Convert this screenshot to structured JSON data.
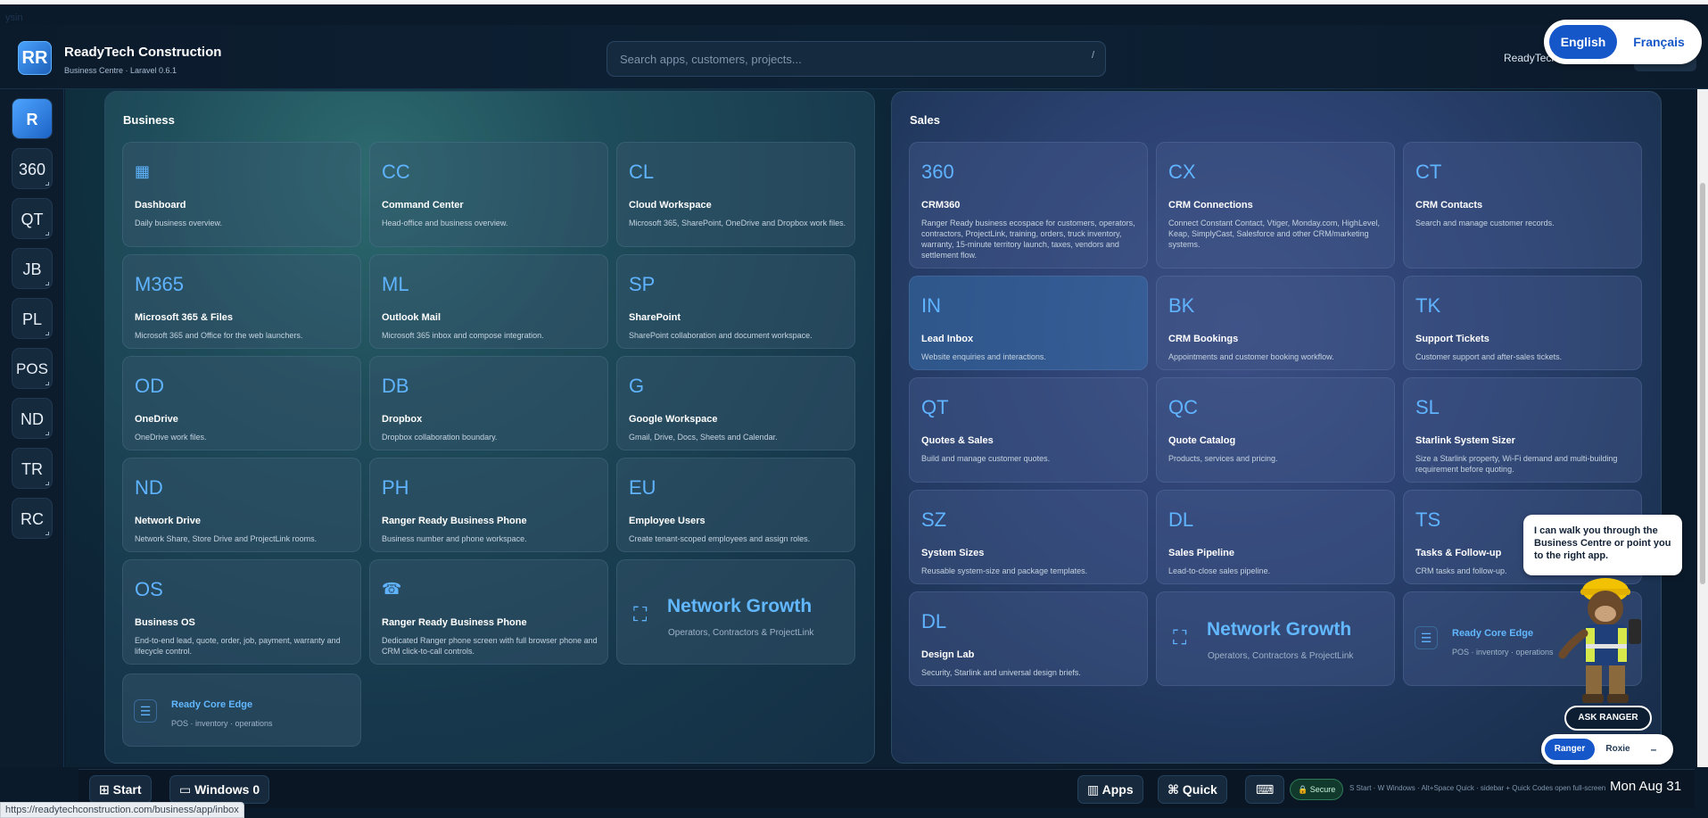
{
  "header": {
    "watermark": "ysin",
    "logo": "RR",
    "title": "ReadyTech Construction",
    "subtitle": "Business Centre · Laravel 0.6.1",
    "search_placeholder": "Search apps, customers, projects...",
    "search_hint": "/",
    "user_name": "ReadyTech"
  },
  "language": {
    "english": "English",
    "french": "Français"
  },
  "sidebar": [
    {
      "label": "R"
    },
    {
      "label": "360"
    },
    {
      "label": "QT"
    },
    {
      "label": "JB"
    },
    {
      "label": "PL"
    },
    {
      "label": "POS"
    },
    {
      "label": "ND"
    },
    {
      "label": "TR"
    },
    {
      "label": "RC"
    }
  ],
  "business": {
    "title": "Business",
    "cards": [
      {
        "abbr": "",
        "icon": "grid-icon",
        "title": "Dashboard",
        "desc": "Daily business overview."
      },
      {
        "abbr": "CC",
        "title": "Command Center",
        "desc": "Head-office and business overview."
      },
      {
        "abbr": "CL",
        "title": "Cloud Workspace",
        "desc": "Microsoft 365, SharePoint, OneDrive and Dropbox work files."
      },
      {
        "abbr": "M365",
        "title": "Microsoft 365 & Files",
        "desc": "Microsoft 365 and Office for the web launchers."
      },
      {
        "abbr": "ML",
        "title": "Outlook Mail",
        "desc": "Microsoft 365 inbox and compose integration."
      },
      {
        "abbr": "SP",
        "title": "SharePoint",
        "desc": "SharePoint collaboration and document workspace."
      },
      {
        "abbr": "OD",
        "title": "OneDrive",
        "desc": "OneDrive work files."
      },
      {
        "abbr": "DB",
        "title": "Dropbox",
        "desc": "Dropbox collaboration boundary."
      },
      {
        "abbr": "G",
        "title": "Google Workspace",
        "desc": "Gmail, Drive, Docs, Sheets and Calendar."
      },
      {
        "abbr": "ND",
        "title": "Network Drive",
        "desc": "Network Share, Store Drive and ProjectLink rooms."
      },
      {
        "abbr": "PH",
        "title": "Ranger Ready Business Phone",
        "desc": "Business number and phone workspace."
      },
      {
        "abbr": "EU",
        "title": "Employee Users",
        "desc": "Create tenant-scoped employees and assign roles."
      },
      {
        "abbr": "OS",
        "title": "Business OS",
        "desc": "End-to-end lead, quote, order, job, payment, warranty and lifecycle control."
      },
      {
        "abbr": "",
        "icon": "phone-icon",
        "title": "Ranger Ready Business Phone",
        "desc": "Dedicated Ranger phone screen with full browser phone and CRM click-to-call controls."
      }
    ],
    "network_growth": {
      "title": "Network Growth",
      "subtitle": "Operators, Contractors & ProjectLink"
    },
    "ready_core": {
      "title": "Ready Core Edge",
      "subtitle": "POS · inventory · operations"
    }
  },
  "sales": {
    "title": "Sales",
    "cards": [
      {
        "abbr": "360",
        "title": "CRM360",
        "desc": "Ranger Ready business ecospace for customers, operators, contractors, ProjectLink, training, orders, truck inventory, warranty, 15-minute territory launch, taxes, vendors and settlement flow."
      },
      {
        "abbr": "CX",
        "title": "CRM Connections",
        "desc": "Connect Constant Contact, Vtiger, Monday.com, HighLevel, Keap, SimplyCast, Salesforce and other CRM/marketing systems."
      },
      {
        "abbr": "CT",
        "title": "CRM Contacts",
        "desc": "Search and manage customer records."
      },
      {
        "abbr": "IN",
        "title": "Lead Inbox",
        "desc": "Website enquiries and interactions."
      },
      {
        "abbr": "BK",
        "title": "CRM Bookings",
        "desc": "Appointments and customer booking workflow."
      },
      {
        "abbr": "TK",
        "title": "Support Tickets",
        "desc": "Customer support and after-sales tickets."
      },
      {
        "abbr": "QT",
        "title": "Quotes & Sales",
        "desc": "Build and manage customer quotes."
      },
      {
        "abbr": "QC",
        "title": "Quote Catalog",
        "desc": "Products, services and pricing."
      },
      {
        "abbr": "SL",
        "title": "Starlink System Sizer",
        "desc": "Size a Starlink property, Wi-Fi demand and multi-building requirement before quoting."
      },
      {
        "abbr": "SZ",
        "title": "System Sizes",
        "desc": "Reusable system-size and package templates."
      },
      {
        "abbr": "DL",
        "title": "Sales Pipeline",
        "desc": "Lead-to-close sales pipeline."
      },
      {
        "abbr": "TS",
        "title": "Tasks & Follow-up",
        "desc": "CRM tasks and follow-up."
      },
      {
        "abbr": "DL",
        "title": "Design Lab",
        "desc": "Security, Starlink and universal design briefs."
      }
    ],
    "network_growth": {
      "title": "Network Growth",
      "subtitle": "Operators, Contractors & ProjectLink"
    },
    "ready_core": {
      "title": "Ready Core Edge",
      "subtitle": "POS · inventory · operations"
    }
  },
  "assistant": {
    "bubble": "I can walk you through the Business Centre or point you to the right app.",
    "ask": "ASK RANGER",
    "ranger": "Ranger",
    "roxie": "Roxie",
    "minimize": "–"
  },
  "taskbar": {
    "start": "Start",
    "windows": "Windows 0",
    "apps": "Apps",
    "quick": "Quick",
    "secure": "Secure",
    "hint": "S Start · W Windows · Alt+Space Quick · sidebar + Quick Codes open full-screen",
    "clock": "Mon Aug 31"
  },
  "status_url": "https://readytechconstruction.com/business/app/inbox"
}
